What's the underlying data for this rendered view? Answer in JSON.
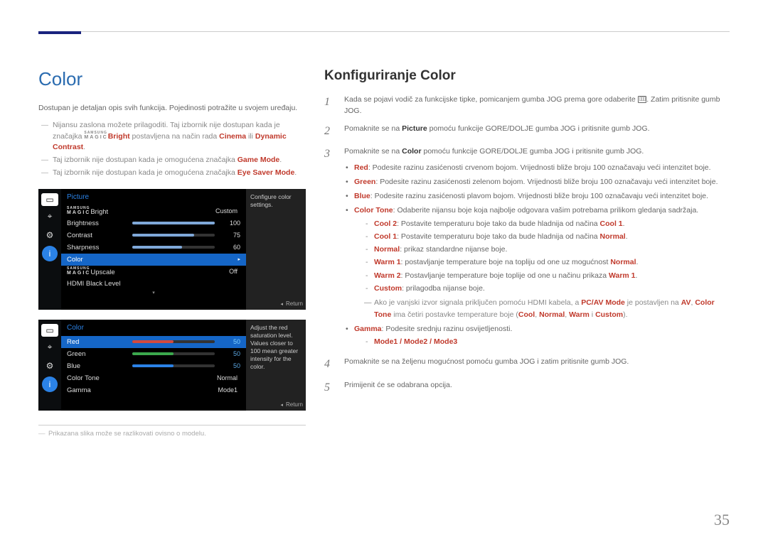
{
  "page_number": "35",
  "left": {
    "heading": "Color",
    "intro": "Dostupan je detaljan opis svih funkcija. Pojedinosti potražite u svojem uređaju.",
    "dash_items": [
      {
        "pre": "Nijansu zaslona možete prilagoditi. Taj izbornik nije dostupan kada je značajka ",
        "magic_sup": "SAMSUNG",
        "magic": "MAGIC",
        "bright": "Bright",
        "mid1": " postavljena na način rada ",
        "hl_a": "Cinema",
        "or": " ili ",
        "hl_b": "Dynamic Contrast",
        "post": "."
      },
      {
        "pre": "Taj izbornik nije dostupan kada je omogućena značajka ",
        "hl_a": "Game Mode",
        "post": "."
      },
      {
        "pre": "Taj izbornik nije dostupan kada je omogućena značajka ",
        "hl_a": "Eye Saver Mode",
        "post": "."
      }
    ],
    "osd1": {
      "title": "Picture",
      "tip": "Configure color settings.",
      "rows": [
        {
          "label_magic": true,
          "label": "Bright",
          "valtxt": "Custom"
        },
        {
          "label": "Brightness",
          "bar_color": "#7fa8d8",
          "bar_pct": 100,
          "val": "100"
        },
        {
          "label": "Contrast",
          "bar_color": "#7fa8d8",
          "bar_pct": 75,
          "val": "75"
        },
        {
          "label": "Sharpness",
          "bar_color": "#7fa8d8",
          "bar_pct": 60,
          "val": "60"
        },
        {
          "label": "Color",
          "selected": true,
          "arrow": true
        },
        {
          "label_magic": true,
          "label": "Upscale",
          "valtxt": "Off"
        },
        {
          "label": "HDMI Black Level"
        }
      ],
      "return": "Return"
    },
    "osd2": {
      "title": "Color",
      "tip": "Adjust the red saturation level. Values closer to 100 mean greater intensity for the color.",
      "rows": [
        {
          "label": "Red",
          "selected": true,
          "bar_color": "#d24a3e",
          "bar_pct": 50,
          "val": "50"
        },
        {
          "label": "Green",
          "bar_color": "#3ba84d",
          "bar_pct": 50,
          "val": "50"
        },
        {
          "label": "Blue",
          "bar_color": "#2b82e6",
          "bar_pct": 50,
          "val": "50"
        },
        {
          "label": "Color Tone",
          "valtxt": "Normal"
        },
        {
          "label": "Gamma",
          "valtxt": "Mode1"
        }
      ],
      "return": "Return"
    },
    "footnote": "Prikazana slika može se razlikovati ovisno o modelu."
  },
  "right": {
    "heading": "Konfiguriranje Color",
    "steps": [
      {
        "num": "1",
        "text_parts": [
          "Kada se pojavi vodič za funkcijske tipke, pomicanjem gumba JOG prema gore odaberite ",
          "ICON",
          ". Zatim pritisnite gumb JOG."
        ]
      },
      {
        "num": "2",
        "text_parts": [
          "Pomaknite se na ",
          {
            "b": "Picture"
          },
          " pomoću funkcije GORE/DOLJE gumba JOG i pritisnite gumb JOG."
        ]
      },
      {
        "num": "3",
        "text_parts": [
          "Pomaknite se na ",
          {
            "b": "Color"
          },
          " pomoću funkcije GORE/DOLJE gumba JOG i pritisnite gumb JOG."
        ],
        "has_bullets": true
      },
      {
        "num": "4",
        "text_parts": [
          "Pomaknite se na željenu mogućnost pomoću gumba JOG i zatim pritisnite gumb JOG."
        ]
      },
      {
        "num": "5",
        "text_parts": [
          "Primijenit će se odabrana opcija."
        ]
      }
    ],
    "bullets": [
      {
        "b": "Red",
        "t": ": Podesite razinu zasićenosti crvenom bojom. Vrijednosti bliže broju 100 označavaju veći intenzitet boje."
      },
      {
        "b": "Green",
        "t": ": Podesite razinu zasićenosti zelenom bojom. Vrijednosti bliže broju 100 označavaju veći intenzitet boje."
      },
      {
        "b": "Blue",
        "t": ": Podesite razinu zasićenosti plavom bojom. Vrijednosti bliže broju 100 označavaju veći intenzitet boje."
      },
      {
        "b": "Color Tone",
        "t": ": Odaberite nijansu boje koja najbolje odgovara vašim potrebama prilikom gledanja sadržaja.",
        "subs": [
          {
            "b": "Cool 2",
            "t": ": Postavite temperaturu boje tako da bude hladnija od načina ",
            "b2": "Cool 1",
            "t2": "."
          },
          {
            "b": "Cool 1",
            "t": ": Postavite temperaturu boje tako da bude hladnija od načina ",
            "b2": "Normal",
            "t2": "."
          },
          {
            "b": "Normal",
            "t": ": prikaz standardne nijanse boje."
          },
          {
            "b": "Warm 1",
            "t": ": postavljanje temperature boje na topliju od one uz mogućnost ",
            "b2": "Normal",
            "t2": "."
          },
          {
            "b": "Warm 2",
            "t": ": Postavljanje temperature boje toplije od one u načinu prikaza ",
            "b2": "Warm 1",
            "t2": "."
          },
          {
            "b": "Custom",
            "t": ": prilagodba nijanse boje."
          }
        ],
        "note": {
          "pre": "Ako je vanjski izvor signala priključen pomoću HDMI kabela, a ",
          "b1": "PC/AV Mode",
          "mid": " je postavljen na ",
          "b2": "AV",
          "mid2": ", ",
          "b3": "Color Tone",
          "mid3": " ima četiri postavke temperature boje (",
          "b4": "Cool",
          "c1": ", ",
          "b5": "Normal",
          "c2": ", ",
          "b6": "Warm",
          "c3": " i ",
          "b7": "Custom",
          "post": ")."
        }
      },
      {
        "b": "Gamma",
        "t": ": Podesite srednju razinu osvijetljenosti.",
        "subs": [
          {
            "raw_b": "Mode1 / Mode2 / Mode3"
          }
        ]
      }
    ]
  }
}
